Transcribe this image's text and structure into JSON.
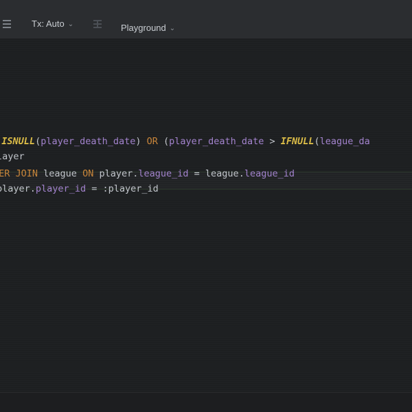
{
  "toolbar": {
    "tx_label": "Tx: Auto",
    "schema_label": "Playground"
  },
  "editor": {
    "lines": [
      {
        "tokens": [
          {
            "t": "(",
            "c": "pn"
          },
          {
            "t": "(",
            "c": "pn"
          },
          {
            "t": "ISNULL",
            "c": "fn"
          },
          {
            "t": "(",
            "c": "pn"
          },
          {
            "t": "player_death_date",
            "c": "fld"
          },
          {
            "t": ") ",
            "c": "pn"
          },
          {
            "t": "OR",
            "c": "kw"
          },
          {
            "t": " (",
            "c": "pn"
          },
          {
            "t": "player_death_date",
            "c": "fld"
          },
          {
            "t": " > ",
            "c": "pn"
          },
          {
            "t": "IFNULL",
            "c": "fn"
          },
          {
            "t": "(",
            "c": "pn"
          },
          {
            "t": "league_da",
            "c": "fld"
          }
        ]
      },
      {
        "tokens": [
          {
            "t": "layer",
            "c": "id"
          }
        ]
      },
      {
        "tokens": [
          {
            "t": "NER JOIN",
            "c": "kw"
          },
          {
            "t": " league ",
            "c": "id"
          },
          {
            "t": "ON",
            "c": "kw"
          },
          {
            "t": " player",
            "c": "id"
          },
          {
            "t": ".",
            "c": "pn"
          },
          {
            "t": "league_id",
            "c": "fld"
          },
          {
            "t": " = league",
            "c": "id"
          },
          {
            "t": ".",
            "c": "pn"
          },
          {
            "t": "league_id",
            "c": "fld"
          }
        ]
      },
      {
        "tokens": [
          {
            "t": "player",
            "c": "id"
          },
          {
            "t": ".",
            "c": "pn"
          },
          {
            "t": "player_id",
            "c": "fld"
          },
          {
            "t": " = :player_id",
            "c": "id"
          }
        ]
      }
    ]
  },
  "colors": {
    "keyword": "#d08a3c",
    "function": "#e2c24a",
    "identifier": "#c8ccd2",
    "field": "#a887d4",
    "background": "#1f2123",
    "toolbar": "#2b2d30"
  }
}
